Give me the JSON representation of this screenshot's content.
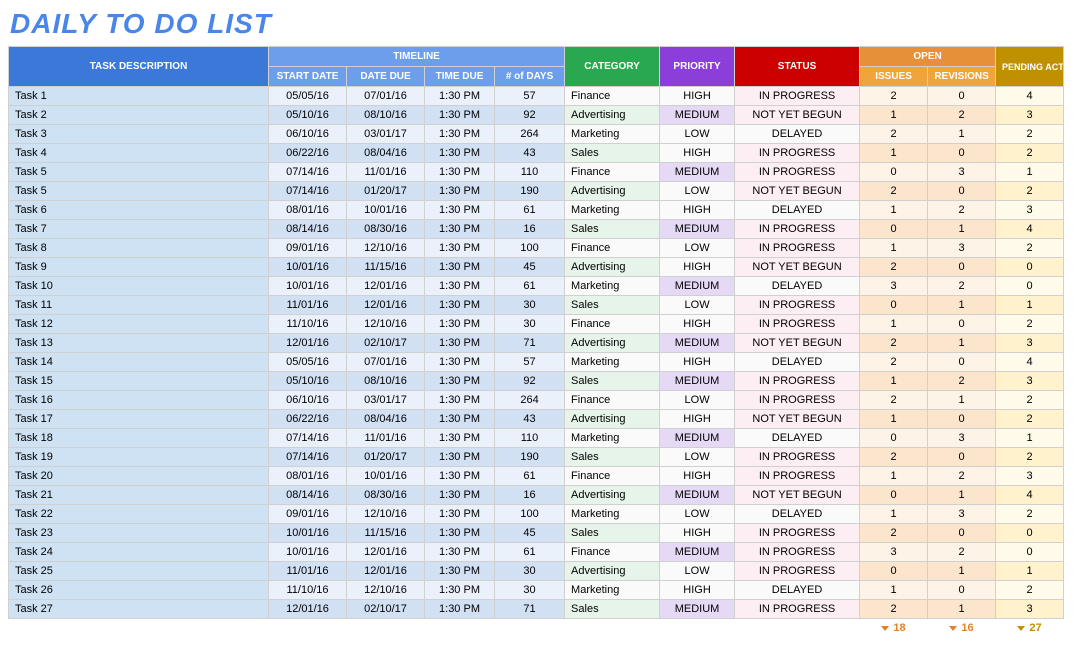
{
  "title": "DAILY TO DO LIST",
  "headers": {
    "task": "TASK DESCRIPTION",
    "timeline": "TIMELINE",
    "category": "CATEGORY",
    "priority": "PRIORITY",
    "status": "STATUS",
    "open": "OPEN",
    "pending": "PENDING ACTIONS",
    "start": "START DATE",
    "due": "DATE DUE",
    "time": "TIME DUE",
    "days": "# of DAYS",
    "issues": "ISSUES",
    "revisions": "REVISIONS"
  },
  "rows": [
    {
      "task": "Task 1",
      "start": "05/05/16",
      "due": "07/01/16",
      "time": "1:30 PM",
      "days": "57",
      "cat": "Finance",
      "pri": "HIGH",
      "sta": "IN PROGRESS",
      "iss": "2",
      "rev": "0",
      "pen": "4"
    },
    {
      "task": "Task 2",
      "start": "05/10/16",
      "due": "08/10/16",
      "time": "1:30 PM",
      "days": "92",
      "cat": "Advertising",
      "pri": "MEDIUM",
      "sta": "NOT YET BEGUN",
      "iss": "1",
      "rev": "2",
      "pen": "3"
    },
    {
      "task": "Task 3",
      "start": "06/10/16",
      "due": "03/01/17",
      "time": "1:30 PM",
      "days": "264",
      "cat": "Marketing",
      "pri": "LOW",
      "sta": "DELAYED",
      "iss": "2",
      "rev": "1",
      "pen": "2"
    },
    {
      "task": "Task 4",
      "start": "06/22/16",
      "due": "08/04/16",
      "time": "1:30 PM",
      "days": "43",
      "cat": "Sales",
      "pri": "HIGH",
      "sta": "IN PROGRESS",
      "iss": "1",
      "rev": "0",
      "pen": "2"
    },
    {
      "task": "Task 5",
      "start": "07/14/16",
      "due": "11/01/16",
      "time": "1:30 PM",
      "days": "110",
      "cat": "Finance",
      "pri": "MEDIUM",
      "sta": "IN PROGRESS",
      "iss": "0",
      "rev": "3",
      "pen": "1"
    },
    {
      "task": "Task 5",
      "start": "07/14/16",
      "due": "01/20/17",
      "time": "1:30 PM",
      "days": "190",
      "cat": "Advertising",
      "pri": "LOW",
      "sta": "NOT YET BEGUN",
      "iss": "2",
      "rev": "0",
      "pen": "2"
    },
    {
      "task": "Task 6",
      "start": "08/01/16",
      "due": "10/01/16",
      "time": "1:30 PM",
      "days": "61",
      "cat": "Marketing",
      "pri": "HIGH",
      "sta": "DELAYED",
      "iss": "1",
      "rev": "2",
      "pen": "3"
    },
    {
      "task": "Task 7",
      "start": "08/14/16",
      "due": "08/30/16",
      "time": "1:30 PM",
      "days": "16",
      "cat": "Sales",
      "pri": "MEDIUM",
      "sta": "IN PROGRESS",
      "iss": "0",
      "rev": "1",
      "pen": "4"
    },
    {
      "task": "Task 8",
      "start": "09/01/16",
      "due": "12/10/16",
      "time": "1:30 PM",
      "days": "100",
      "cat": "Finance",
      "pri": "LOW",
      "sta": "IN PROGRESS",
      "iss": "1",
      "rev": "3",
      "pen": "2"
    },
    {
      "task": "Task 9",
      "start": "10/01/16",
      "due": "11/15/16",
      "time": "1:30 PM",
      "days": "45",
      "cat": "Advertising",
      "pri": "HIGH",
      "sta": "NOT YET BEGUN",
      "iss": "2",
      "rev": "0",
      "pen": "0"
    },
    {
      "task": "Task 10",
      "start": "10/01/16",
      "due": "12/01/16",
      "time": "1:30 PM",
      "days": "61",
      "cat": "Marketing",
      "pri": "MEDIUM",
      "sta": "DELAYED",
      "iss": "3",
      "rev": "2",
      "pen": "0"
    },
    {
      "task": "Task 11",
      "start": "11/01/16",
      "due": "12/01/16",
      "time": "1:30 PM",
      "days": "30",
      "cat": "Sales",
      "pri": "LOW",
      "sta": "IN PROGRESS",
      "iss": "0",
      "rev": "1",
      "pen": "1"
    },
    {
      "task": "Task 12",
      "start": "11/10/16",
      "due": "12/10/16",
      "time": "1:30 PM",
      "days": "30",
      "cat": "Finance",
      "pri": "HIGH",
      "sta": "IN PROGRESS",
      "iss": "1",
      "rev": "0",
      "pen": "2"
    },
    {
      "task": "Task 13",
      "start": "12/01/16",
      "due": "02/10/17",
      "time": "1:30 PM",
      "days": "71",
      "cat": "Advertising",
      "pri": "MEDIUM",
      "sta": "NOT YET BEGUN",
      "iss": "2",
      "rev": "1",
      "pen": "3"
    },
    {
      "task": "Task 14",
      "start": "05/05/16",
      "due": "07/01/16",
      "time": "1:30 PM",
      "days": "57",
      "cat": "Marketing",
      "pri": "HIGH",
      "sta": "DELAYED",
      "iss": "2",
      "rev": "0",
      "pen": "4"
    },
    {
      "task": "Task 15",
      "start": "05/10/16",
      "due": "08/10/16",
      "time": "1:30 PM",
      "days": "92",
      "cat": "Sales",
      "pri": "MEDIUM",
      "sta": "IN PROGRESS",
      "iss": "1",
      "rev": "2",
      "pen": "3"
    },
    {
      "task": "Task 16",
      "start": "06/10/16",
      "due": "03/01/17",
      "time": "1:30 PM",
      "days": "264",
      "cat": "Finance",
      "pri": "LOW",
      "sta": "IN PROGRESS",
      "iss": "2",
      "rev": "1",
      "pen": "2"
    },
    {
      "task": "Task 17",
      "start": "06/22/16",
      "due": "08/04/16",
      "time": "1:30 PM",
      "days": "43",
      "cat": "Advertising",
      "pri": "HIGH",
      "sta": "NOT YET BEGUN",
      "iss": "1",
      "rev": "0",
      "pen": "2"
    },
    {
      "task": "Task 18",
      "start": "07/14/16",
      "due": "11/01/16",
      "time": "1:30 PM",
      "days": "110",
      "cat": "Marketing",
      "pri": "MEDIUM",
      "sta": "DELAYED",
      "iss": "0",
      "rev": "3",
      "pen": "1"
    },
    {
      "task": "Task 19",
      "start": "07/14/16",
      "due": "01/20/17",
      "time": "1:30 PM",
      "days": "190",
      "cat": "Sales",
      "pri": "LOW",
      "sta": "IN PROGRESS",
      "iss": "2",
      "rev": "0",
      "pen": "2"
    },
    {
      "task": "Task 20",
      "start": "08/01/16",
      "due": "10/01/16",
      "time": "1:30 PM",
      "days": "61",
      "cat": "Finance",
      "pri": "HIGH",
      "sta": "IN PROGRESS",
      "iss": "1",
      "rev": "2",
      "pen": "3"
    },
    {
      "task": "Task 21",
      "start": "08/14/16",
      "due": "08/30/16",
      "time": "1:30 PM",
      "days": "16",
      "cat": "Advertising",
      "pri": "MEDIUM",
      "sta": "NOT YET BEGUN",
      "iss": "0",
      "rev": "1",
      "pen": "4"
    },
    {
      "task": "Task 22",
      "start": "09/01/16",
      "due": "12/10/16",
      "time": "1:30 PM",
      "days": "100",
      "cat": "Marketing",
      "pri": "LOW",
      "sta": "DELAYED",
      "iss": "1",
      "rev": "3",
      "pen": "2"
    },
    {
      "task": "Task 23",
      "start": "10/01/16",
      "due": "11/15/16",
      "time": "1:30 PM",
      "days": "45",
      "cat": "Sales",
      "pri": "HIGH",
      "sta": "IN PROGRESS",
      "iss": "2",
      "rev": "0",
      "pen": "0"
    },
    {
      "task": "Task 24",
      "start": "10/01/16",
      "due": "12/01/16",
      "time": "1:30 PM",
      "days": "61",
      "cat": "Finance",
      "pri": "MEDIUM",
      "sta": "IN PROGRESS",
      "iss": "3",
      "rev": "2",
      "pen": "0"
    },
    {
      "task": "Task 25",
      "start": "11/01/16",
      "due": "12/01/16",
      "time": "1:30 PM",
      "days": "30",
      "cat": "Advertising",
      "pri": "LOW",
      "sta": "IN PROGRESS",
      "iss": "0",
      "rev": "1",
      "pen": "1"
    },
    {
      "task": "Task 26",
      "start": "11/10/16",
      "due": "12/10/16",
      "time": "1:30 PM",
      "days": "30",
      "cat": "Marketing",
      "pri": "HIGH",
      "sta": "DELAYED",
      "iss": "1",
      "rev": "0",
      "pen": "2"
    },
    {
      "task": "Task 27",
      "start": "12/01/16",
      "due": "02/10/17",
      "time": "1:30 PM",
      "days": "71",
      "cat": "Sales",
      "pri": "MEDIUM",
      "sta": "IN PROGRESS",
      "iss": "2",
      "rev": "1",
      "pen": "3"
    }
  ],
  "totals": {
    "issues": "18",
    "revisions": "16",
    "pending": "27"
  },
  "highlightRows": [
    1,
    3,
    5,
    7,
    9,
    11,
    13,
    15,
    17,
    19,
    21,
    23,
    25,
    27
  ]
}
